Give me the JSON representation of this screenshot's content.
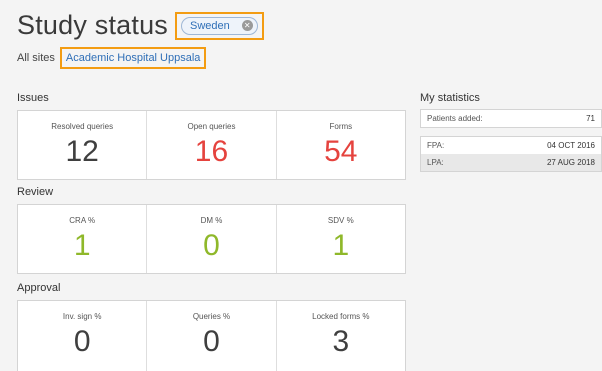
{
  "header": {
    "title": "Study status",
    "country_filter": "Sweden",
    "all_sites": "All sites",
    "site": "Academic Hospital Uppsala"
  },
  "sections": {
    "issues": {
      "label": "Issues",
      "cards": [
        {
          "label": "Resolved queries",
          "value": "12",
          "color": "#3f3f3f"
        },
        {
          "label": "Open queries",
          "value": "16",
          "color": "#e5433e"
        },
        {
          "label": "Forms",
          "value": "54",
          "color": "#e5433e"
        }
      ]
    },
    "review": {
      "label": "Review",
      "cards": [
        {
          "label": "CRA %",
          "value": "1",
          "color": "#8fb82a"
        },
        {
          "label": "DM %",
          "value": "0",
          "color": "#8fb82a"
        },
        {
          "label": "SDV %",
          "value": "1",
          "color": "#8fb82a"
        }
      ]
    },
    "approval": {
      "label": "Approval",
      "cards": [
        {
          "label": "Inv. sign %",
          "value": "0",
          "color": "#3f3f3f"
        },
        {
          "label": "Queries %",
          "value": "0",
          "color": "#3f3f3f"
        },
        {
          "label": "Locked forms %",
          "value": "3",
          "color": "#3f3f3f"
        }
      ]
    }
  },
  "my_statistics": {
    "title": "My statistics",
    "patients_added_label": "Patients added:",
    "patients_added_value": "71",
    "fpa_label": "FPA:",
    "fpa_value": "04 OCT 2016",
    "lpa_label": "LPA:",
    "lpa_value": "27 AUG 2018"
  },
  "icons": {
    "chip_close": "close-icon"
  }
}
